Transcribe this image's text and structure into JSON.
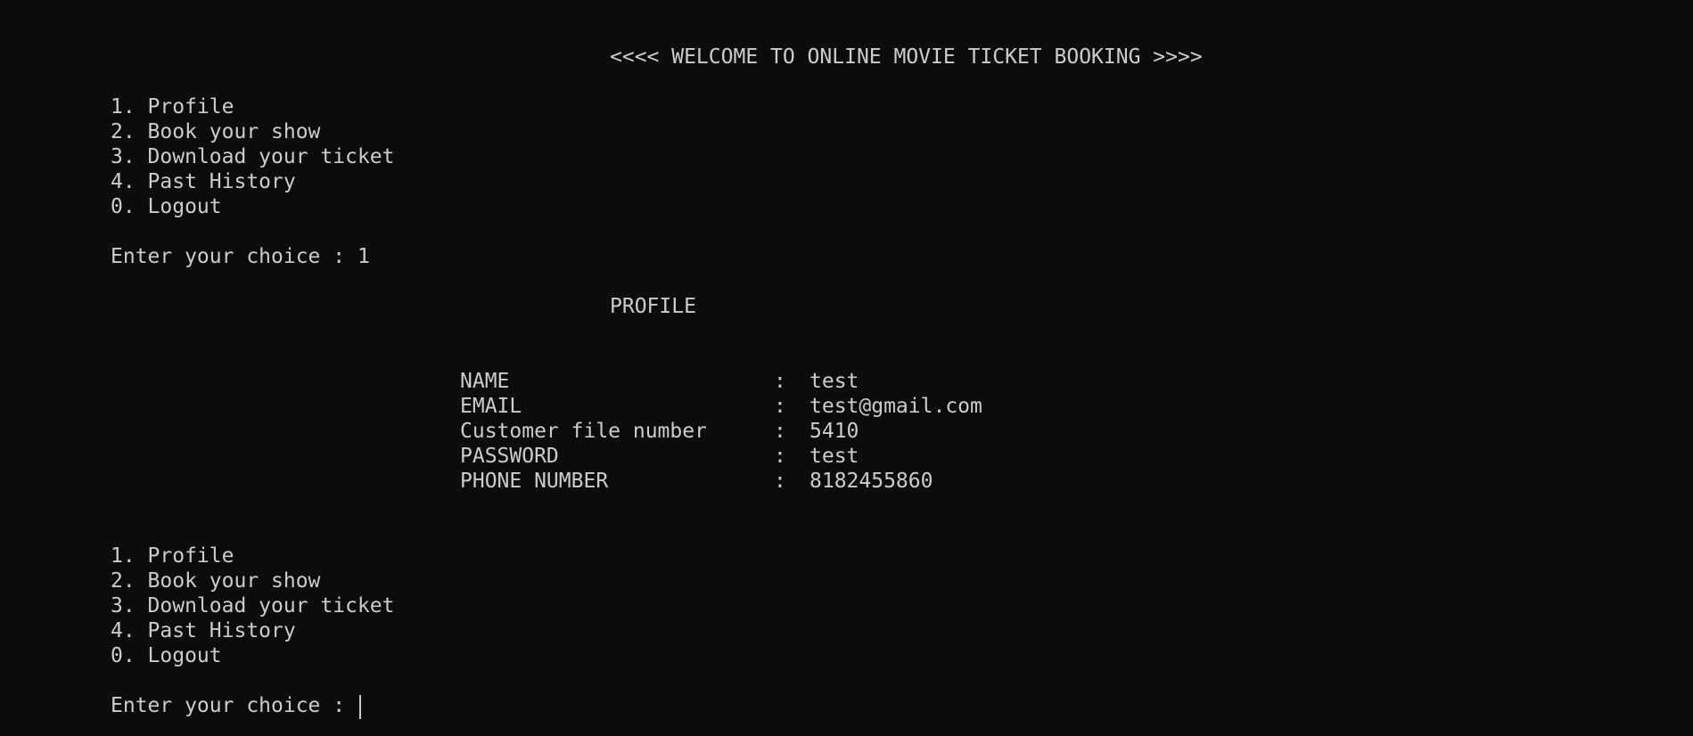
{
  "window": {
    "background": "#0c0c0c",
    "foreground": "#cccccc"
  },
  "banner": "<<<< WELCOME TO ONLINE MOVIE TICKET BOOKING >>>>",
  "menu": [
    "1. Profile",
    "2. Book your show",
    "3. Download your ticket",
    "4. Past History",
    "0. Logout"
  ],
  "first_prompt": "Enter your choice : 1",
  "profile": {
    "title": "PROFILE",
    "separator": ":",
    "fields": [
      {
        "label": "NAME",
        "value": "test"
      },
      {
        "label": "EMAIL",
        "value": "test@gmail.com"
      },
      {
        "label": "Customer file number",
        "value": "5410"
      },
      {
        "label": "PASSWORD",
        "value": "test"
      },
      {
        "label": "PHONE NUMBER",
        "value": "8182455860"
      }
    ]
  },
  "second_prompt": "Enter your choice : "
}
